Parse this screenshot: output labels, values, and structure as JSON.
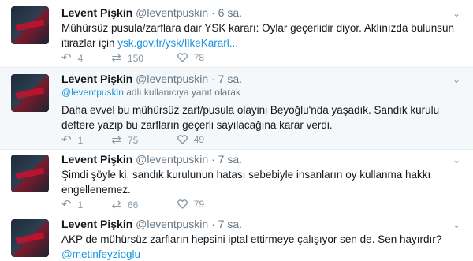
{
  "tweets": [
    {
      "name": "Levent Pişkin",
      "handle": "@leventpuskin",
      "time": "· 6 sa.",
      "text_before": "Mühürsüz pusula/zarflara dair YSK kararı: Oylar geçerlidir diyor. Aklınızda bulunsun itirazlar için ",
      "link": "ysk.gov.tr/ysk/IlkeKararl...",
      "replies": "4",
      "retweets": "150",
      "likes": "78"
    },
    {
      "name": "Levent Pişkin",
      "handle": "@leventpuskin",
      "time": "· 7 sa.",
      "replying_handle": "@leventpuskin",
      "replying_rest": " adlı kullanıcıya yanıt olarak",
      "text": "Daha evvel bu mühürsüz zarf/pusula olayini Beyoğlu'nda yaşadık. Sandık kurulu deftere yazıp bu zarfların geçerli sayılacağına karar verdi.",
      "replies": "1",
      "retweets": "75",
      "likes": "49"
    },
    {
      "name": "Levent Pişkin",
      "handle": "@leventpuskin",
      "time": "· 7 sa.",
      "text": "Şimdi şöyle ki, sandık kurulunun hatası sebebiyle insanların oy kullanma hakkı engellenemez.",
      "replies": "1",
      "retweets": "66",
      "likes": "79"
    },
    {
      "name": "Levent Pişkin",
      "handle": "@leventpuskin",
      "time": "· 7 sa.",
      "text_before": "AKP de mühürsüz zarfların hepsini iptal ettirmeye çalışıyor sen de. Sen hayırdır? ",
      "link": "@metinfeyzioglu"
    }
  ],
  "icons": {
    "reply": "reply-icon",
    "retweet": "retweet-icon",
    "like": "heart-icon",
    "more": "chevron-down-icon"
  },
  "colors": {
    "link": "#1b95e0",
    "muted": "#657786",
    "reply_background": "#f5f8fa"
  }
}
